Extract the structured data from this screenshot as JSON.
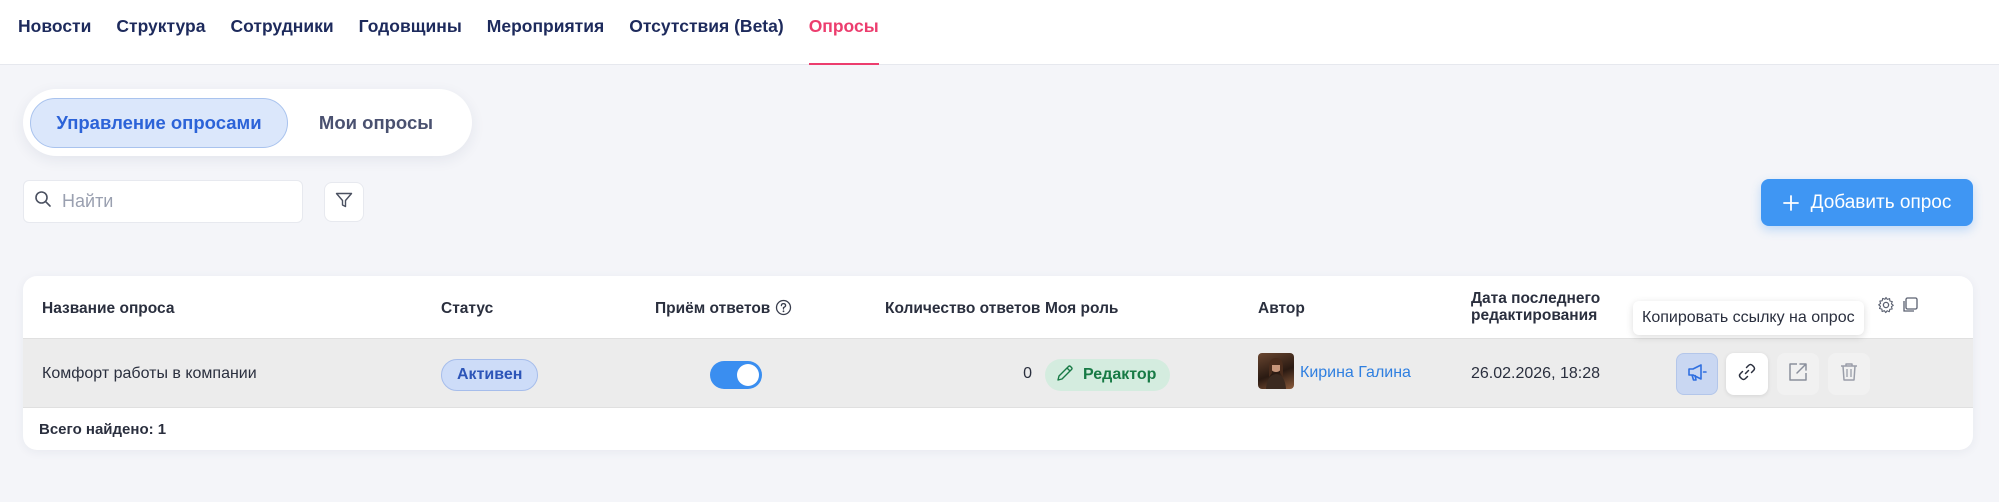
{
  "nav": {
    "items": [
      {
        "label": "Новости",
        "active": false
      },
      {
        "label": "Структура",
        "active": false
      },
      {
        "label": "Сотрудники",
        "active": false
      },
      {
        "label": "Годовщины",
        "active": false
      },
      {
        "label": "Мероприятия",
        "active": false
      },
      {
        "label": "Отсутствия (Beta)",
        "active": false
      },
      {
        "label": "Опросы",
        "active": true
      }
    ]
  },
  "tabs": {
    "manage": "Управление опросами",
    "mine": "Мои опросы",
    "active": "manage"
  },
  "search": {
    "placeholder": "Найти",
    "value": ""
  },
  "add_button": {
    "label": "Добавить опрос"
  },
  "table": {
    "columns": {
      "name": "Название опроса",
      "status": "Статус",
      "accepting": "Приём ответов",
      "count": "Количество ответов",
      "role": "Моя роль",
      "author": "Автор",
      "date_line1": "Дата последнего",
      "date_line2": "редактирования"
    },
    "rows": [
      {
        "name": "Комфорт работы в компании",
        "status": "Активен",
        "accepting": true,
        "count": "0",
        "role": "Редактор",
        "author": "Кирина Галина",
        "date": "26.02.2026, 18:28"
      }
    ],
    "total": "Всего найдено: 1"
  },
  "tooltip": "Копировать ссылку на опрос",
  "colors": {
    "accent": "#3f96f3",
    "nav_active": "#ec3d6e",
    "status_active_bg": "#cddcf8",
    "role_bg": "#d4ecdf"
  },
  "icons": {
    "search": "search-icon",
    "filter": "filter-icon",
    "plus": "plus-icon",
    "help": "help-circle-icon",
    "settings": "gear-icon",
    "copy": "copy-icon",
    "pencil": "pencil-icon",
    "megaphone": "megaphone-icon",
    "link": "link-icon",
    "open": "external-link-icon",
    "trash": "trash-icon"
  }
}
